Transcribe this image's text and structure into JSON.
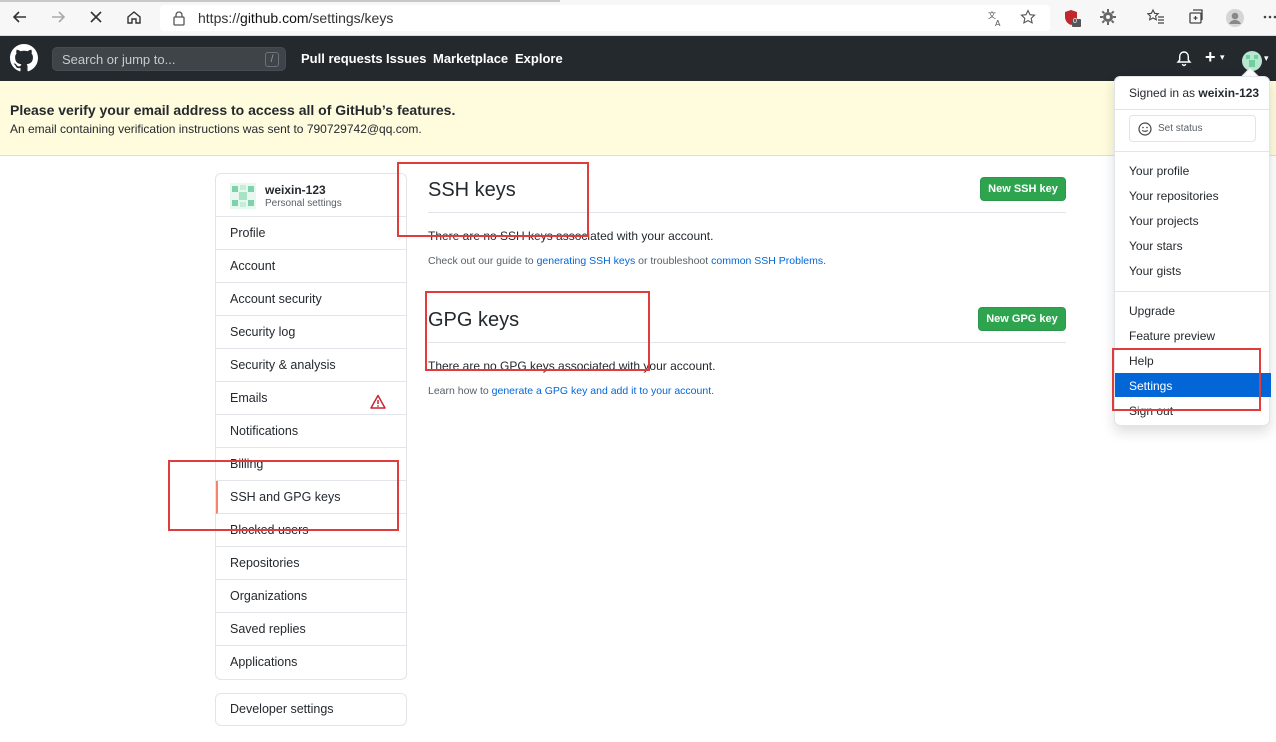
{
  "browser": {
    "url_prefix": "https://",
    "url_host": "github.com",
    "url_path": "/settings/keys",
    "extension_badge": "0"
  },
  "header": {
    "search_placeholder": "Search or jump to...",
    "search_shortcut": "/",
    "nav": [
      "Pull requests",
      "Issues",
      "Marketplace",
      "Explore"
    ],
    "plus_label": "+",
    "caret": "▾"
  },
  "banner": {
    "title": "Please verify your email address to access all of GitHub’s features.",
    "subtitle": "An email containing verification instructions was sent to 790729742@qq.com."
  },
  "sidebar": {
    "username": "weixin-123",
    "subtitle": "Personal settings",
    "items": [
      {
        "label": "Profile"
      },
      {
        "label": "Account"
      },
      {
        "label": "Account security"
      },
      {
        "label": "Security log"
      },
      {
        "label": "Security & analysis"
      },
      {
        "label": "Emails"
      },
      {
        "label": "Notifications"
      },
      {
        "label": "Billing"
      },
      {
        "label": "SSH and GPG keys"
      },
      {
        "label": "Blocked users"
      },
      {
        "label": "Repositories"
      },
      {
        "label": "Organizations"
      },
      {
        "label": "Saved replies"
      },
      {
        "label": "Applications"
      }
    ],
    "active_item": "SSH and GPG keys",
    "developer_settings": "Developer settings"
  },
  "ssh": {
    "title": "SSH keys",
    "button": "New SSH key",
    "empty": "There are no SSH keys associated with your account.",
    "help_prefix": "Check out our guide to ",
    "help_link1": "generating SSH keys",
    "help_middle": " or troubleshoot ",
    "help_link2": "common SSH Problems",
    "help_suffix": "."
  },
  "gpg": {
    "title": "GPG keys",
    "button": "New GPG key",
    "empty": "There are no GPG keys associated with your account.",
    "help_prefix": "Learn how to ",
    "help_link": "generate a GPG key and add it to your account",
    "help_suffix": "."
  },
  "dropdown": {
    "signed_in_prefix": "Signed in as ",
    "signed_in_user": "weixin-123",
    "set_status": "Set status",
    "group1": [
      "Your profile",
      "Your repositories",
      "Your projects",
      "Your stars",
      "Your gists"
    ],
    "group2": [
      "Upgrade",
      "Feature preview",
      "Help",
      "Settings",
      "Sign out"
    ],
    "active_item": "Settings"
  },
  "colors": {
    "header_bg": "#24292e",
    "banner_bg": "#fffbdd",
    "primary_button": "#2ea44f",
    "link": "#0366d6",
    "active_border": "#f9826c",
    "annotation": "#e03c3c"
  }
}
